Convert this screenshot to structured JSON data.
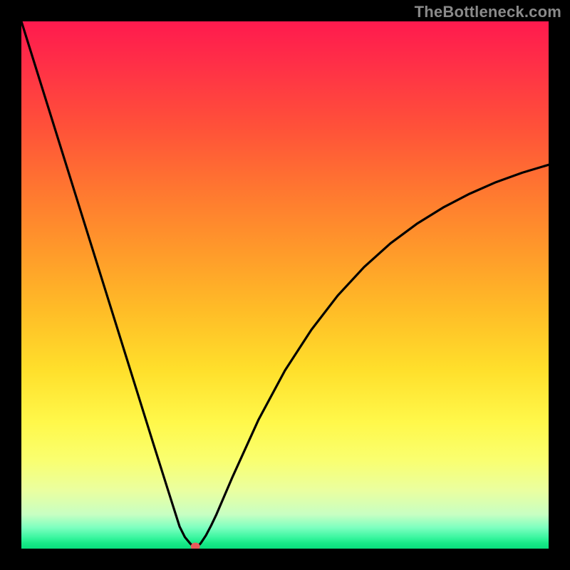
{
  "watermark": "TheBottleneck.com",
  "chart_data": {
    "type": "line",
    "title": "",
    "xlabel": "",
    "ylabel": "",
    "xlim": [
      0,
      100
    ],
    "ylim": [
      0,
      100
    ],
    "grid": false,
    "legend": false,
    "series": [
      {
        "name": "curve",
        "x": [
          0,
          5,
          10,
          15,
          20,
          25,
          28,
          30,
          31,
          32,
          33,
          34,
          35,
          36,
          37,
          40,
          45,
          50,
          55,
          60,
          65,
          70,
          75,
          80,
          85,
          90,
          95,
          100
        ],
        "y": [
          100,
          84,
          68,
          52,
          36,
          20,
          10.5,
          4.2,
          2.2,
          1.0,
          0.0,
          1.0,
          2.5,
          4.4,
          6.5,
          13.5,
          24.5,
          33.8,
          41.5,
          48.0,
          53.4,
          57.9,
          61.6,
          64.7,
          67.3,
          69.5,
          71.3,
          72.8
        ]
      }
    ],
    "marker": {
      "x": 33,
      "y": 0,
      "color": "#e85a5a"
    },
    "gradient_stops": [
      {
        "pos": 0,
        "color": "#ff1a4e"
      },
      {
        "pos": 8,
        "color": "#ff2f47"
      },
      {
        "pos": 20,
        "color": "#ff5139"
      },
      {
        "pos": 32,
        "color": "#ff7730"
      },
      {
        "pos": 44,
        "color": "#ff9b2a"
      },
      {
        "pos": 55,
        "color": "#ffbd27"
      },
      {
        "pos": 66,
        "color": "#ffdf2b"
      },
      {
        "pos": 76,
        "color": "#fff84a"
      },
      {
        "pos": 83,
        "color": "#faff6e"
      },
      {
        "pos": 89,
        "color": "#eaffa0"
      },
      {
        "pos": 93.5,
        "color": "#c8ffc2"
      },
      {
        "pos": 96,
        "color": "#7dffc0"
      },
      {
        "pos": 98,
        "color": "#36f59d"
      },
      {
        "pos": 99,
        "color": "#17e887"
      },
      {
        "pos": 100,
        "color": "#0adf7d"
      }
    ]
  }
}
